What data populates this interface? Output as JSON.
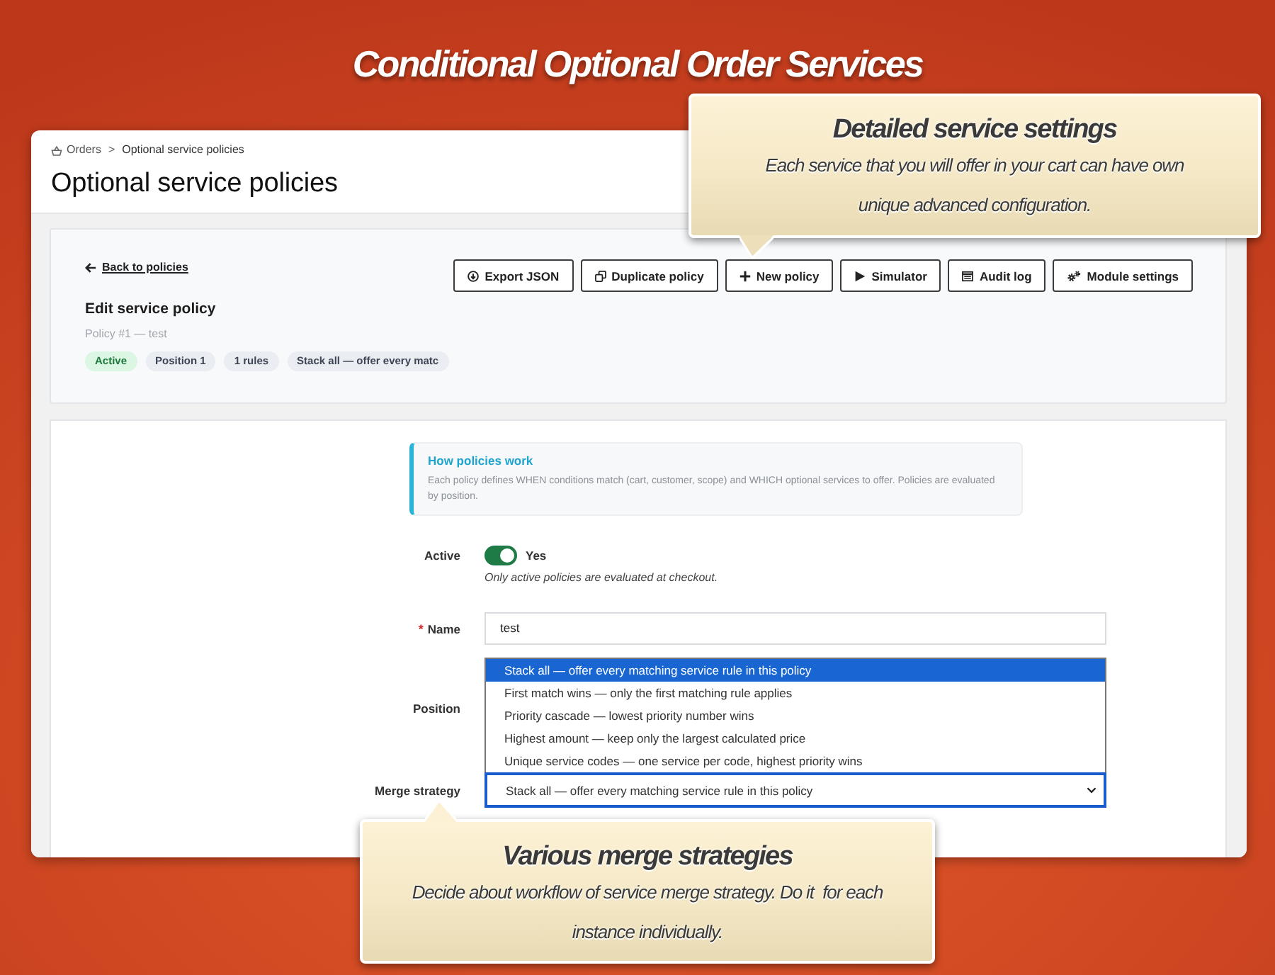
{
  "headline": "Conditional Optional Order Services",
  "breadcrumb": {
    "items": [
      {
        "label": "Orders"
      },
      {
        "label": "Optional service policies"
      }
    ],
    "separator": ">"
  },
  "page_title": "Optional service policies",
  "header": {
    "back_link": "Back to policies",
    "buttons": [
      {
        "label": "Export JSON"
      },
      {
        "label": "Duplicate policy"
      },
      {
        "label": "New policy"
      },
      {
        "label": "Simulator"
      },
      {
        "label": "Audit log"
      },
      {
        "label": "Module settings"
      }
    ],
    "title": "Edit service policy",
    "subtitle": "Policy #1 — test",
    "badges": [
      {
        "label": "Active",
        "kind": "status"
      },
      {
        "label": "Position 1",
        "kind": "info"
      },
      {
        "label": "1 rules",
        "kind": "info"
      },
      {
        "label": "Stack all — offer every matc",
        "kind": "info"
      }
    ]
  },
  "info_box": {
    "title": "How policies work",
    "text": "Each policy defines WHEN conditions match (cart, customer, scope) and WHICH optional services to offer. Policies are evaluated by position."
  },
  "form": {
    "active": {
      "label": "Active",
      "on": true,
      "value_label": "Yes",
      "hint": "Only active policies are evaluated at checkout."
    },
    "name": {
      "label": "Name",
      "required_mark": "*",
      "value": "test"
    },
    "position": {
      "label": "Position"
    },
    "merge_strategy": {
      "label": "Merge strategy",
      "value": "Stack all — offer every matching service rule in this policy",
      "expanded": true,
      "options": [
        {
          "label": "Stack all — offer every matching service rule in this policy",
          "selected": true
        },
        {
          "label": "First match wins — only the first matching rule applies",
          "selected": false
        },
        {
          "label": "Priority cascade — lowest priority number wins",
          "selected": false
        },
        {
          "label": "Highest amount — keep only the largest calculated price",
          "selected": false
        },
        {
          "label": "Unique service codes — one service per code, highest priority wins",
          "selected": false
        }
      ]
    }
  },
  "callouts": [
    {
      "title": "Detailed service settings",
      "text": "Each service that you will offer in your cart can have own unique advanced configuration."
    },
    {
      "title": "Various merge strategies",
      "text": "Decide about workflow of service merge strategy. Do it  for each instance individually."
    }
  ]
}
